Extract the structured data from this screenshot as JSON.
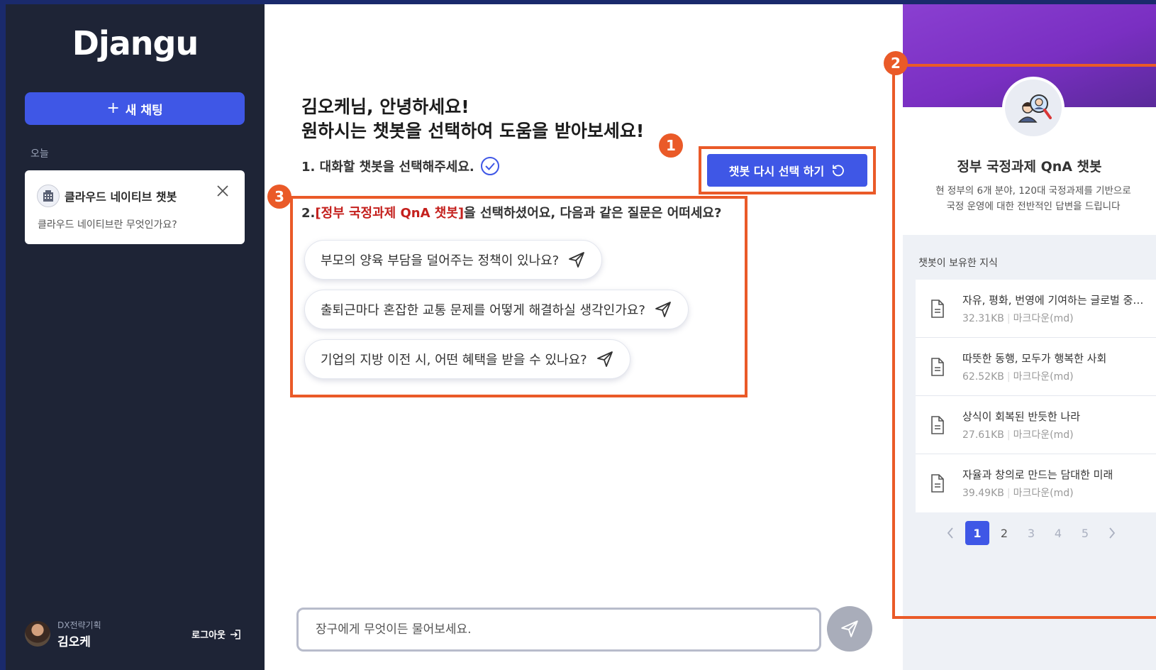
{
  "sidebar": {
    "logo": "Djangu",
    "new_chat_label": "새 채팅",
    "section_today": "오늘",
    "chat": {
      "title": "클라우드 네이티브 챗봇",
      "preview": "클라우드 네이티브란 무엇인가요?"
    },
    "user": {
      "department": "DX전략기획",
      "name": "김오케"
    },
    "logout_label": "로그아웃"
  },
  "main": {
    "greeting_line1": "김오케님, 안녕하세요!",
    "greeting_line2": "원하시는 챗봇을 선택하여 도움을 받아보세요!",
    "step1": "1. 대화할 챗봇을 선택해주세요.",
    "reselect_label": "챗봇 다시 선택 하기",
    "step2_prefix": "2.",
    "step2_highlight": "[정부 국정과제 QnA 챗봇]",
    "step2_suffix": "을 선택하셨어요, 다음과 같은 질문은 어떠세요?",
    "questions": [
      "부모의 양육 부담을 덜어주는 정책이 있나요?",
      "출퇴근마다 혼잡한 교통 문제를 어떻게 해결하실 생각인가요?",
      "기업의 지방 이전 시, 어떤 혜택을 받을 수 있나요?"
    ],
    "input_placeholder": "장구에게 무엇이든 물어보세요."
  },
  "annotations": {
    "badge1": "1",
    "badge2": "2",
    "badge3": "3"
  },
  "right_panel": {
    "bot_name": "정부 국정과제 QnA 챗봇",
    "bot_desc_line1": "현 정부의 6개 분야, 120대 국정과제를 기반으로",
    "bot_desc_line2": "국정 운영에 대한 전반적인 답변을 드립니다",
    "knowledge_label": "챗봇이 보유한 지식",
    "files": [
      {
        "name": "자유, 평화, 번영에 기여하는 글로벌 중추국가",
        "size": "32.31KB",
        "type": "마크다운(md)"
      },
      {
        "name": "따뜻한 동행, 모두가 행복한 사회",
        "size": "62.52KB",
        "type": "마크다운(md)"
      },
      {
        "name": "상식이 회복된 반듯한 나라",
        "size": "27.61KB",
        "type": "마크다운(md)"
      },
      {
        "name": "자율과 창의로 만드는 담대한 미래",
        "size": "39.49KB",
        "type": "마크다운(md)"
      }
    ],
    "pagination": {
      "pages": [
        "1",
        "2",
        "3",
        "4",
        "5"
      ],
      "current": "1"
    }
  },
  "colors": {
    "accent": "#3f57e6",
    "annotation": "#ea5a28",
    "highlight": "#c4201d",
    "sidebar_bg": "#1e2436",
    "header_purple": "#7a2fc2"
  }
}
